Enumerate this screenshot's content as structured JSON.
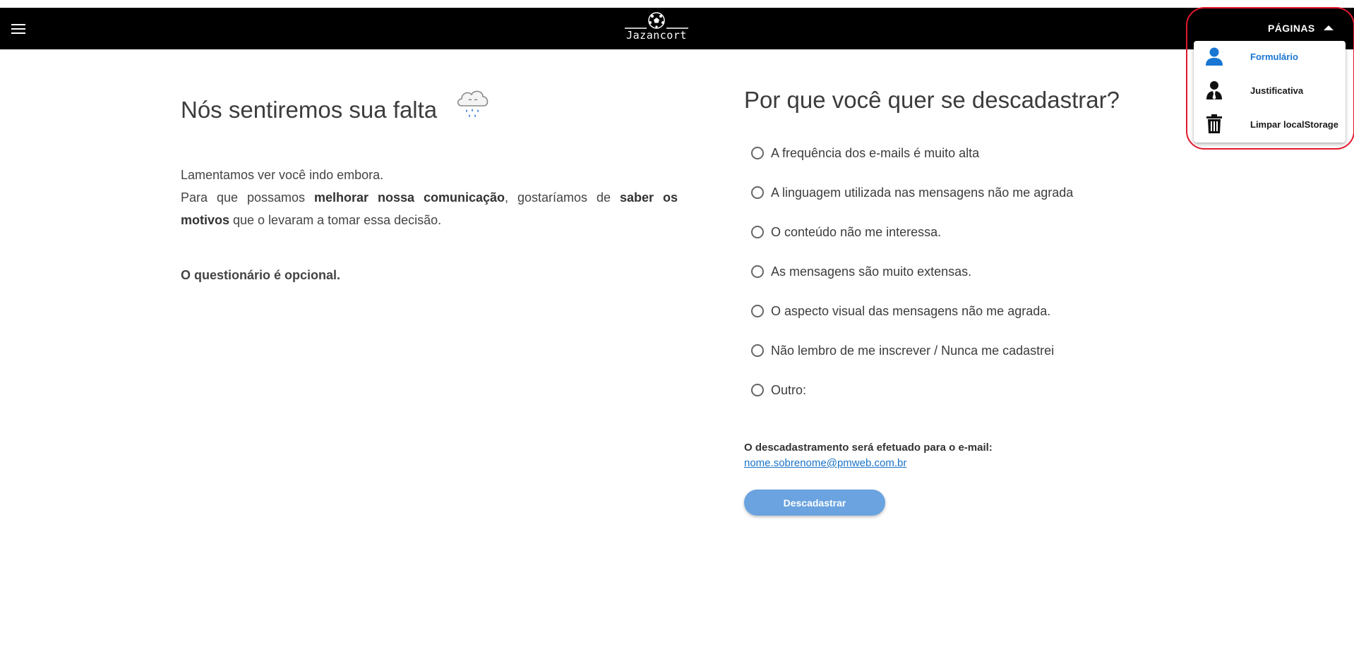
{
  "header": {
    "logo_text": "Jazancort",
    "menu_icon": "hamburger-menu-icon",
    "paginas_label": "PÁGINAS",
    "paginas_icon": "caret-up-icon"
  },
  "dropdown": {
    "items": [
      {
        "label": "Formulário",
        "icon": "person-icon",
        "active": true
      },
      {
        "label": "Justificativa",
        "icon": "person-tie-icon",
        "active": false
      },
      {
        "label": "Limpar localStorage",
        "icon": "trash-icon",
        "active": false
      }
    ]
  },
  "left": {
    "title": "Nós sentiremos sua falta",
    "title_icon": "rain-cloud-icon",
    "lament": "Lamentamos ver você indo embora.",
    "para_a": "Para que possamos ",
    "para_b": "melhorar nossa comunicação",
    "para_c": ", gostaríamos de ",
    "para_d": "saber os motivos",
    "para_e": " que o levaram a tomar essa decisão.",
    "optional": "O questionário é opcional."
  },
  "right": {
    "title": "Por que você quer se descadastrar?",
    "options": [
      "A frequência dos e-mails é muito alta",
      "A linguagem utilizada nas mensagens não me agrada",
      "O conteúdo não me interessa.",
      "As mensagens são muito extensas.",
      "O aspecto visual das mensagens não me agrada.",
      "Não lembro de me inscrever / Nunca me cadastrei",
      "Outro:"
    ],
    "email_note": "O descadastramento será efetuado para o e-mail:",
    "email": "nome.sobrenome@pmweb.com.br",
    "button_label": "Descadastrar"
  },
  "colors": {
    "appbar": "#000000",
    "accent": "#1976d2",
    "button": "#6aa3e0",
    "highlight": "#e2192d"
  }
}
